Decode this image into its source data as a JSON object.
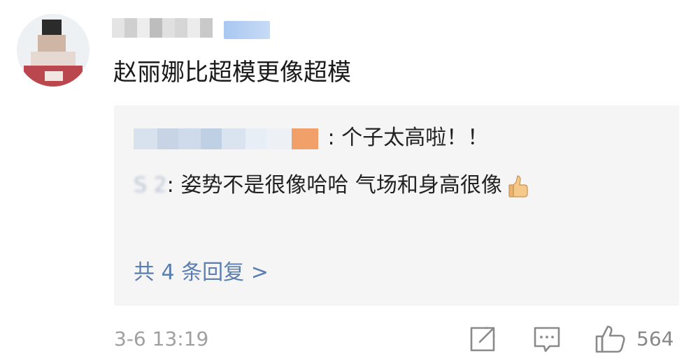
{
  "comment": {
    "text": "赵丽娜比超模更像超模",
    "timestamp": "3-6 13:19",
    "like_count": "564"
  },
  "replies": [
    {
      "text": ": 个子太高啦！！"
    },
    {
      "author_visible": "S                 2",
      "text": ": 姿势不是很像哈哈 气场和身高很像"
    }
  ],
  "view_replies_label": "共 4 条回复 >",
  "icons": {
    "share": "share-icon",
    "comment": "comment-icon",
    "like": "thumbs-up-icon",
    "emoji": "thumbs-up-emoji"
  },
  "colors": {
    "link": "#5b7eb0",
    "reply_bg": "#f5f5f5",
    "meta": "#a0a0a0",
    "badge": "#a9c7f0",
    "author_tag": "#f08a4b"
  }
}
